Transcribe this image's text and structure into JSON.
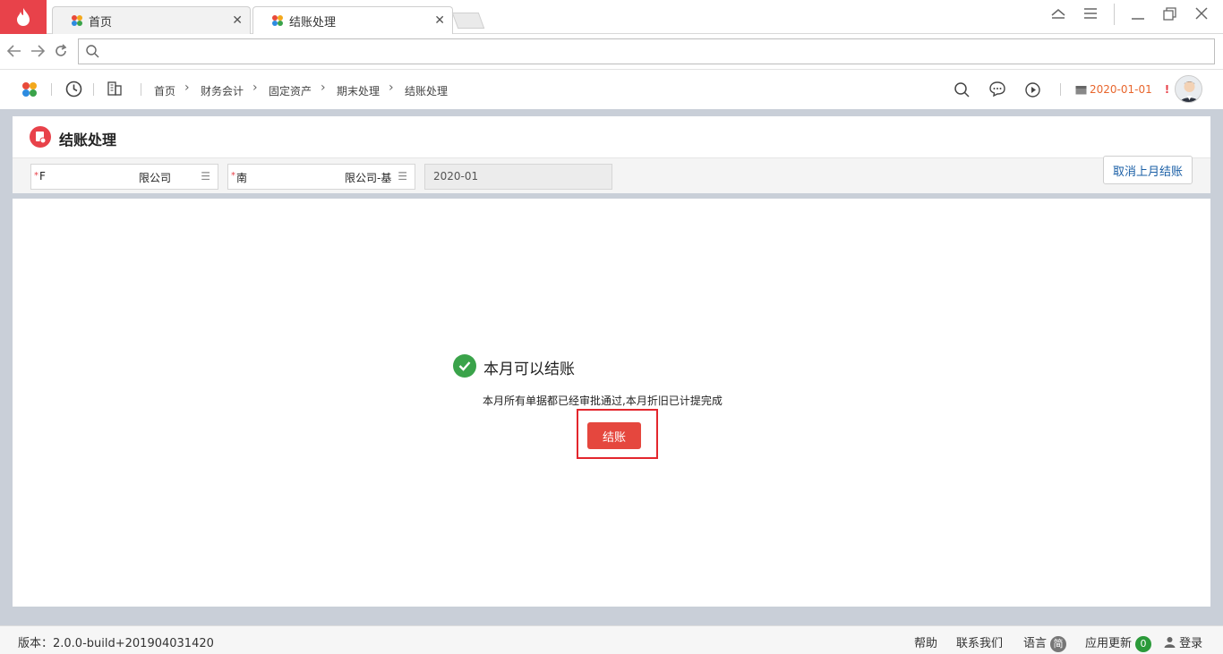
{
  "browser": {
    "tabs": [
      {
        "label": "首页"
      },
      {
        "label": "结账处理"
      }
    ],
    "close_glyph": "✕"
  },
  "breadcrumb": [
    "首页",
    "财务会计",
    "固定资产",
    "期末处理",
    "结账处理"
  ],
  "header": {
    "date": "2020-01-01",
    "alert": "!"
  },
  "page": {
    "title": "结账处理",
    "filters": {
      "org_left": "F",
      "org_right": "限公司",
      "book_left": "南",
      "book_right": "限公司-基",
      "period": "2020-01"
    },
    "cancel_button": "取消上月结账"
  },
  "result": {
    "title": "本月可以结账",
    "description": "本月所有单据都已经审批通过,本月折旧已计提完成",
    "button": "结账"
  },
  "footer": {
    "version": "版本：2.0.0-build+201904031420",
    "help": "帮助",
    "contact": "联系我们",
    "language": "语言",
    "language_badge": "简",
    "updates": "应用更新",
    "updates_count": "0",
    "login": "登录"
  },
  "colors": {
    "brand": "#e8424a",
    "success": "#3aa34a",
    "primary_button": "#e5473e",
    "date_accent": "#e8662d"
  }
}
